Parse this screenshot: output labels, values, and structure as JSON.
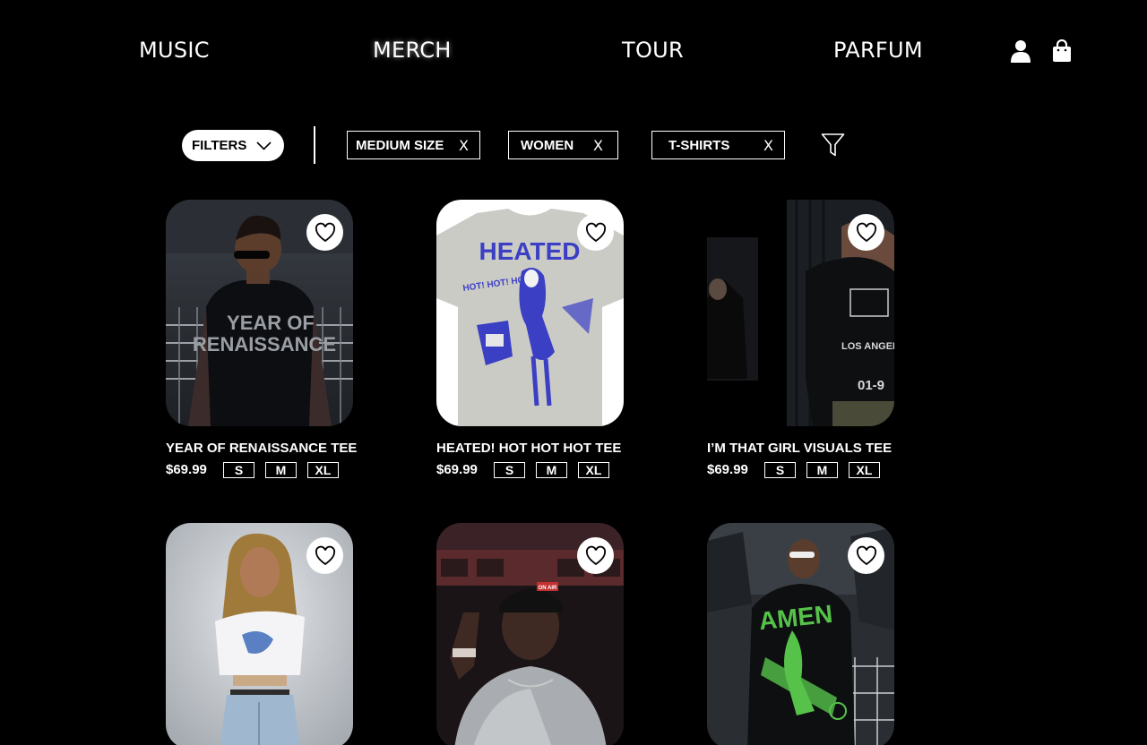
{
  "nav": {
    "links": [
      {
        "label": "MUSIC",
        "active": false
      },
      {
        "label": "MERCH",
        "active": true
      },
      {
        "label": "TOUR",
        "active": false
      },
      {
        "label": "PARFUM",
        "active": false
      }
    ],
    "icons": [
      "user-icon",
      "shopping-bag-icon"
    ]
  },
  "filters": {
    "button_label": "FILTERS",
    "chips": [
      {
        "label": "MEDIUM SIZE",
        "remove": "X"
      },
      {
        "label": "WOMEN",
        "remove": "X"
      },
      {
        "label": "T-SHIRTS",
        "remove": "X"
      }
    ]
  },
  "products": [
    {
      "title": "YEAR OF RENAISSANCE TEE",
      "price": "$69.99",
      "sizes": [
        "S",
        "M",
        "XL"
      ]
    },
    {
      "title": "HEATED! HOT HOT HOT TEE",
      "price": "$69.99",
      "sizes": [
        "S",
        "M",
        "XL"
      ]
    },
    {
      "title": "I’M THAT GIRL VISUALS TEE",
      "price": "$69.99",
      "sizes": [
        "S",
        "M",
        "XL"
      ]
    },
    {
      "title": "",
      "price": "",
      "sizes": []
    },
    {
      "title": "",
      "price": "",
      "sizes": []
    },
    {
      "title": "",
      "price": "",
      "sizes": []
    }
  ],
  "image_text": {
    "p1_print": "YEAR OF RENAISSANCE",
    "p2_print": "HEATED",
    "p2_sub": "HOT! HOT! HOT!",
    "p3_print": "LOS ANGELES",
    "p3_sub": "01-9",
    "p5_cap": "ON AIR",
    "p6_print": "AMEN"
  },
  "colors": {
    "background": "#000000",
    "text": "#ffffff",
    "heated_blue": "#3b3fc4"
  }
}
